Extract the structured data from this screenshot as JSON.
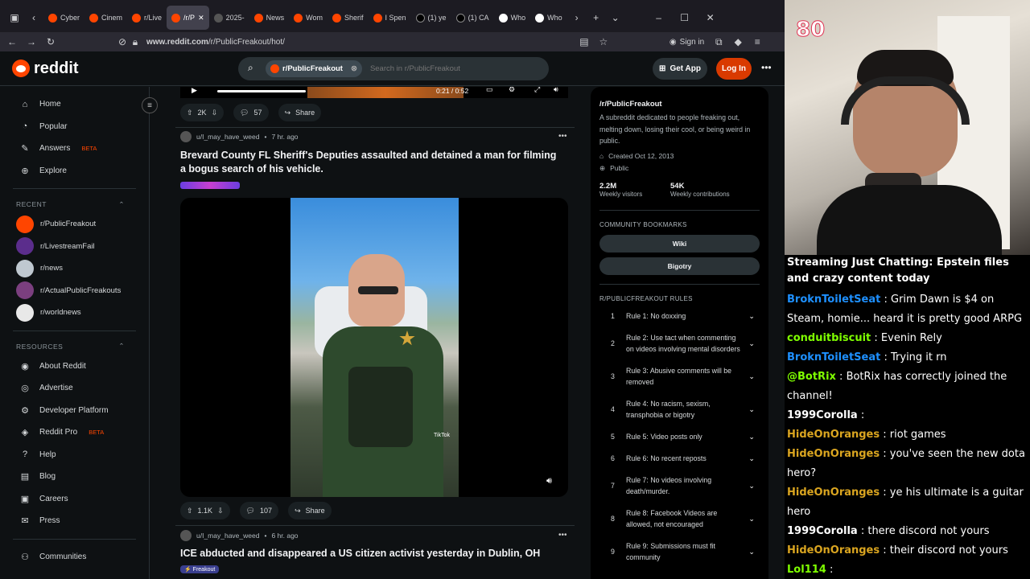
{
  "browser": {
    "tabs": [
      {
        "label": "Cyber",
        "icon": "youtube-icon"
      },
      {
        "label": "Cinem",
        "icon": "youtube-icon"
      },
      {
        "label": "r/Live",
        "icon": "reddit-icon"
      },
      {
        "label": "/r/P",
        "icon": "reddit-icon",
        "active": true
      },
      {
        "label": "2025-",
        "icon": "doc-icon"
      },
      {
        "label": "News",
        "icon": "reddit-icon"
      },
      {
        "label": "Wom",
        "icon": "reddit-icon"
      },
      {
        "label": "Sherif",
        "icon": "reddit-icon"
      },
      {
        "label": "I Spen",
        "icon": "reddit-icon"
      },
      {
        "label": "(1) ye",
        "icon": "x-icon"
      },
      {
        "label": "(1) CA",
        "icon": "x-icon"
      },
      {
        "label": "Who",
        "icon": "wiki-icon"
      },
      {
        "label": "Who",
        "icon": "wiki-icon"
      }
    ],
    "url_host": "www.reddit.com",
    "url_path": "/r/PublicFreakout/hot/",
    "sign_in": "Sign in"
  },
  "header": {
    "logo": "reddit",
    "search_chip": "r/PublicFreakout",
    "search_placeholder": "Search in r/PublicFreakout",
    "get_app": "Get App",
    "log_in": "Log In"
  },
  "left_nav": {
    "items": [
      "Home",
      "Popular",
      "Answers",
      "Explore"
    ],
    "answers_badge": "BETA",
    "recent_header": "RECENT",
    "recent": [
      "r/PublicFreakout",
      "r/LivestreamFail",
      "r/news",
      "r/ActualPublicFreakouts",
      "r/worldnews"
    ],
    "resources_header": "RESOURCES",
    "resources": [
      "About Reddit",
      "Advertise",
      "Developer Platform",
      "Reddit Pro",
      "Help",
      "Blog",
      "Careers",
      "Press"
    ],
    "pro_badge": "BETA",
    "communities": "Communities"
  },
  "feed": {
    "top_post": {
      "time": "0:21 / 0:52",
      "votes": "2K",
      "comments": "57",
      "share": "Share"
    },
    "post1": {
      "user": "u/I_may_have_weed",
      "age": "7 hr. ago",
      "title": "Brevard County FL Sheriff's Deputies assaulted and detained a man for filming a bogus search of his vehicle.",
      "votes": "1.1K",
      "comments": "107",
      "share": "Share",
      "tiktok": "TikTok"
    },
    "post2": {
      "user": "u/I_may_have_weed",
      "age": "6 hr. ago",
      "title": "ICE abducted and disappeared a US citizen activist yesterday in Dublin, OH",
      "flair": "Freakout"
    }
  },
  "sidebar": {
    "name": "/r/PublicFreakout",
    "description": "A subreddit dedicated to people freaking out, melting down, losing their cool, or being weird in public.",
    "created": "Created Oct 12, 2013",
    "visibility": "Public",
    "visitors": "2.2M",
    "visitors_label": "Weekly visitors",
    "contributions": "54K",
    "contributions_label": "Weekly contributions",
    "bookmarks_header": "COMMUNITY BOOKMARKS",
    "bookmarks": [
      "Wiki",
      "Bigotry"
    ],
    "rules_header": "R/PUBLICFREAKOUT RULES",
    "rules": [
      "Rule 1: No doxxing",
      "Rule 2: Use tact when commenting on videos involving mental disorders",
      "Rule 3: Abusive comments will be removed",
      "Rule 4: No racism, sexism, transphobia or bigotry",
      "Rule 5: Video posts only",
      "Rule 6: No recent reposts",
      "Rule 7: No videos involving death/murder.",
      "Rule 8: Facebook Videos are allowed, not encouraged",
      "Rule 9: Submissions must fit community"
    ]
  },
  "stream": {
    "counter": "80",
    "title": "Streaming Just Chatting: Epstein files and crazy content today",
    "chat": [
      {
        "user": "BroknToiletSeat",
        "msg": "Grim Dawn is $4 on Steam, homie... heard it is pretty good ARPG",
        "cls": "u1"
      },
      {
        "user": "conduitbiscuit",
        "msg": "Evenin Rely",
        "cls": "u3"
      },
      {
        "user": "BroknToiletSeat",
        "msg": "Trying it rn",
        "cls": "u1"
      },
      {
        "user": "@BotRix",
        "msg": "BotRix has correctly joined the channel!",
        "cls": "u3"
      },
      {
        "user": "1999Corolla",
        "msg": "",
        "cls": "u4"
      },
      {
        "user": "HideOnOranges",
        "msg": "riot games",
        "cls": "u2"
      },
      {
        "user": "HideOnOranges",
        "msg": "you've seen the new dota hero?",
        "cls": "u2"
      },
      {
        "user": "HideOnOranges",
        "msg": "ye his ultimate is a guitar hero",
        "cls": "u2"
      },
      {
        "user": "1999Corolla",
        "msg": "there discord not yours",
        "cls": "u4"
      },
      {
        "user": "HideOnOranges",
        "msg": "their discord not yours",
        "cls": "u2"
      },
      {
        "user": "Lol114",
        "msg": "",
        "cls": "u3"
      },
      {
        "user": "Lol114",
        "msg": "",
        "cls": "u3"
      }
    ]
  }
}
